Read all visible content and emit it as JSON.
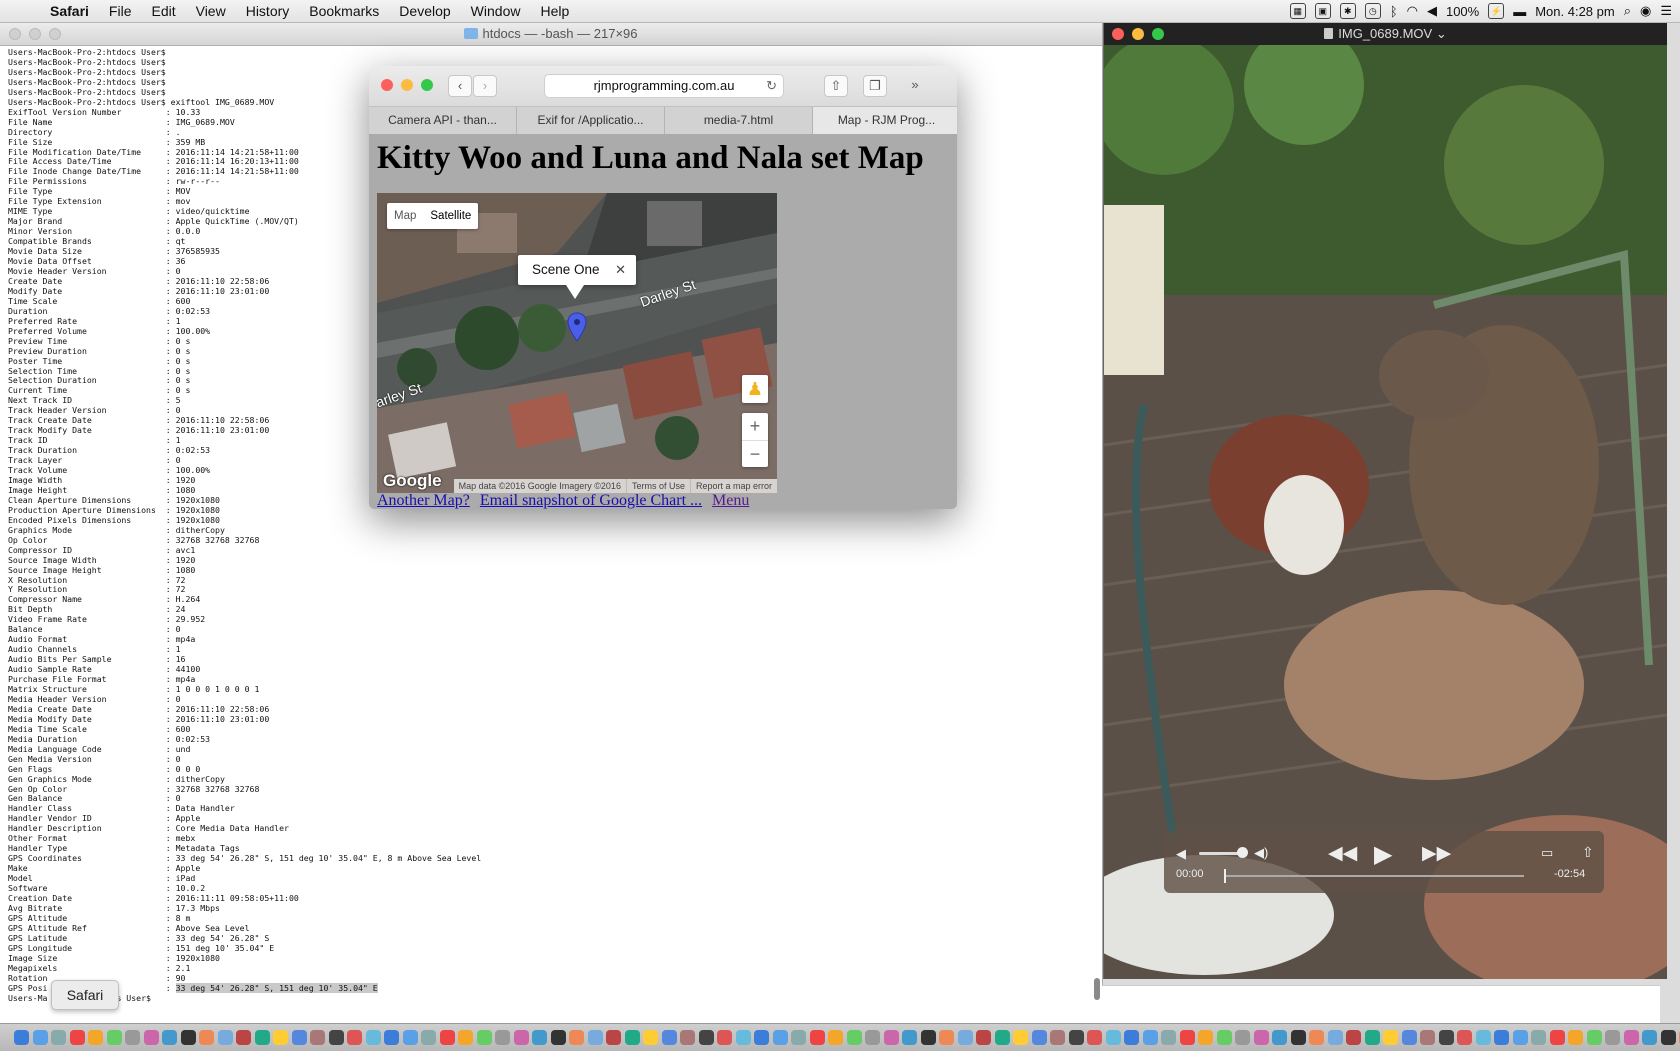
{
  "menubar": {
    "app": "Safari",
    "items": [
      "File",
      "Edit",
      "View",
      "History",
      "Bookmarks",
      "Develop",
      "Window",
      "Help"
    ],
    "battery": "100%",
    "clock": "Mon. 4:28 pm"
  },
  "terminal": {
    "title": "htdocs — -bash — 217×96",
    "lines": [
      "Users-MacBook-Pro-2:htdocs User$",
      "Users-MacBook-Pro-2:htdocs User$",
      "Users-MacBook-Pro-2:htdocs User$",
      "Users-MacBook-Pro-2:htdocs User$",
      "Users-MacBook-Pro-2:htdocs User$",
      "Users-MacBook-Pro-2:htdocs User$ exiftool IMG_0689.MOV",
      "ExifTool Version Number         : 10.33",
      "File Name                       : IMG_0689.MOV",
      "Directory                       : .",
      "File Size                       : 359 MB",
      "File Modification Date/Time     : 2016:11:14 14:21:58+11:00",
      "File Access Date/Time           : 2016:11:14 16:20:13+11:00",
      "File Inode Change Date/Time     : 2016:11:14 14:21:58+11:00",
      "File Permissions                : rw-r--r--",
      "File Type                       : MOV",
      "File Type Extension             : mov",
      "MIME Type                       : video/quicktime",
      "Major Brand                     : Apple QuickTime (.MOV/QT)",
      "Minor Version                   : 0.0.0",
      "Compatible Brands               : qt",
      "Movie Data Size                 : 376585935",
      "Movie Data Offset               : 36",
      "Movie Header Version            : 0",
      "Create Date                     : 2016:11:10 22:58:06",
      "Modify Date                     : 2016:11:10 23:01:00",
      "Time Scale                      : 600",
      "Duration                        : 0:02:53",
      "Preferred Rate                  : 1",
      "Preferred Volume                : 100.00%",
      "Preview Time                    : 0 s",
      "Preview Duration                : 0 s",
      "Poster Time                     : 0 s",
      "Selection Time                  : 0 s",
      "Selection Duration              : 0 s",
      "Current Time                    : 0 s",
      "Next Track ID                   : 5",
      "Track Header Version            : 0",
      "Track Create Date               : 2016:11:10 22:58:06",
      "Track Modify Date               : 2016:11:10 23:01:00",
      "Track ID                        : 1",
      "Track Duration                  : 0:02:53",
      "Track Layer                     : 0",
      "Track Volume                    : 100.00%",
      "Image Width                     : 1920",
      "Image Height                    : 1080",
      "Clean Aperture Dimensions       : 1920x1080",
      "Production Aperture Dimensions  : 1920x1080",
      "Encoded Pixels Dimensions       : 1920x1080",
      "Graphics Mode                   : ditherCopy",
      "Op Color                        : 32768 32768 32768",
      "Compressor ID                   : avc1",
      "Source Image Width              : 1920",
      "Source Image Height             : 1080",
      "X Resolution                    : 72",
      "Y Resolution                    : 72",
      "Compressor Name                 : H.264",
      "Bit Depth                       : 24",
      "Video Frame Rate                : 29.952",
      "Balance                         : 0",
      "Audio Format                    : mp4a",
      "Audio Channels                  : 1",
      "Audio Bits Per Sample           : 16",
      "Audio Sample Rate               : 44100",
      "Purchase File Format            : mp4a",
      "Matrix Structure                : 1 0 0 0 1 0 0 0 1",
      "Media Header Version            : 0",
      "Media Create Date               : 2016:11:10 22:58:06",
      "Media Modify Date               : 2016:11:10 23:01:00",
      "Media Time Scale                : 600",
      "Media Duration                  : 0:02:53",
      "Media Language Code             : und",
      "Gen Media Version               : 0",
      "Gen Flags                       : 0 0 0",
      "Gen Graphics Mode               : ditherCopy",
      "Gen Op Color                    : 32768 32768 32768",
      "Gen Balance                     : 0",
      "Handler Class                   : Data Handler",
      "Handler Vendor ID               : Apple",
      "Handler Description             : Core Media Data Handler",
      "Other Format                    : mebx",
      "Handler Type                    : Metadata Tags",
      "GPS Coordinates                 : 33 deg 54' 26.28\" S, 151 deg 10' 35.04\" E, 8 m Above Sea Level",
      "Make                            : Apple",
      "Model                           : iPad",
      "Software                        : 10.0.2",
      "Creation Date                   : 2016:11:11 09:58:05+11:00",
      "Avg Bitrate                     : 17.3 Mbps",
      "GPS Altitude                    : 8 m",
      "GPS Altitude Ref                : Above Sea Level",
      "GPS Latitude                    : 33 deg 54' 26.28\" S",
      "GPS Longitude                   : 151 deg 10' 35.04\" E",
      "Image Size                      : 1920x1080",
      "Megapixels                      : 2.1",
      "Rotation                        : 90",
      "GPS Posi                        : 33 deg 54' 26.28\" S, 151 deg 10' 35.04\" E",
      "Users-Ma          tdocs User$ "
    ],
    "tooltip": "Safari"
  },
  "safari": {
    "url": "rjmprogramming.com.au",
    "tabs": [
      "Camera API - than...",
      "Exif for /Applicatio...",
      "media-7.html",
      "Map - RJM Prog..."
    ],
    "active_tab": 3,
    "page_title": "Kitty Woo and Luna and Nala set Map",
    "map": {
      "type_map": "Map",
      "type_satellite": "Satellite",
      "infowindow": "Scene One",
      "street_1": "Darley St",
      "street_2": "arley St",
      "zoom_in": "+",
      "zoom_out": "−",
      "logo": "Google",
      "attribution": "Map data ©2016 Google Imagery ©2016",
      "terms": "Terms of Use",
      "report": "Report a map error"
    },
    "links": [
      "Another Map?",
      "Email snapshot of Google Chart ...",
      "Menu"
    ]
  },
  "quicktime": {
    "title": "IMG_0689.MOV",
    "time_elapsed": "00:00",
    "time_remaining": "-02:54",
    "progress": 0
  },
  "colors": {
    "close": "#fc605c",
    "minimize": "#fdbc40",
    "zoom": "#34c84a",
    "link": "#1a0dab",
    "map_pin": "#4a5ee8"
  }
}
